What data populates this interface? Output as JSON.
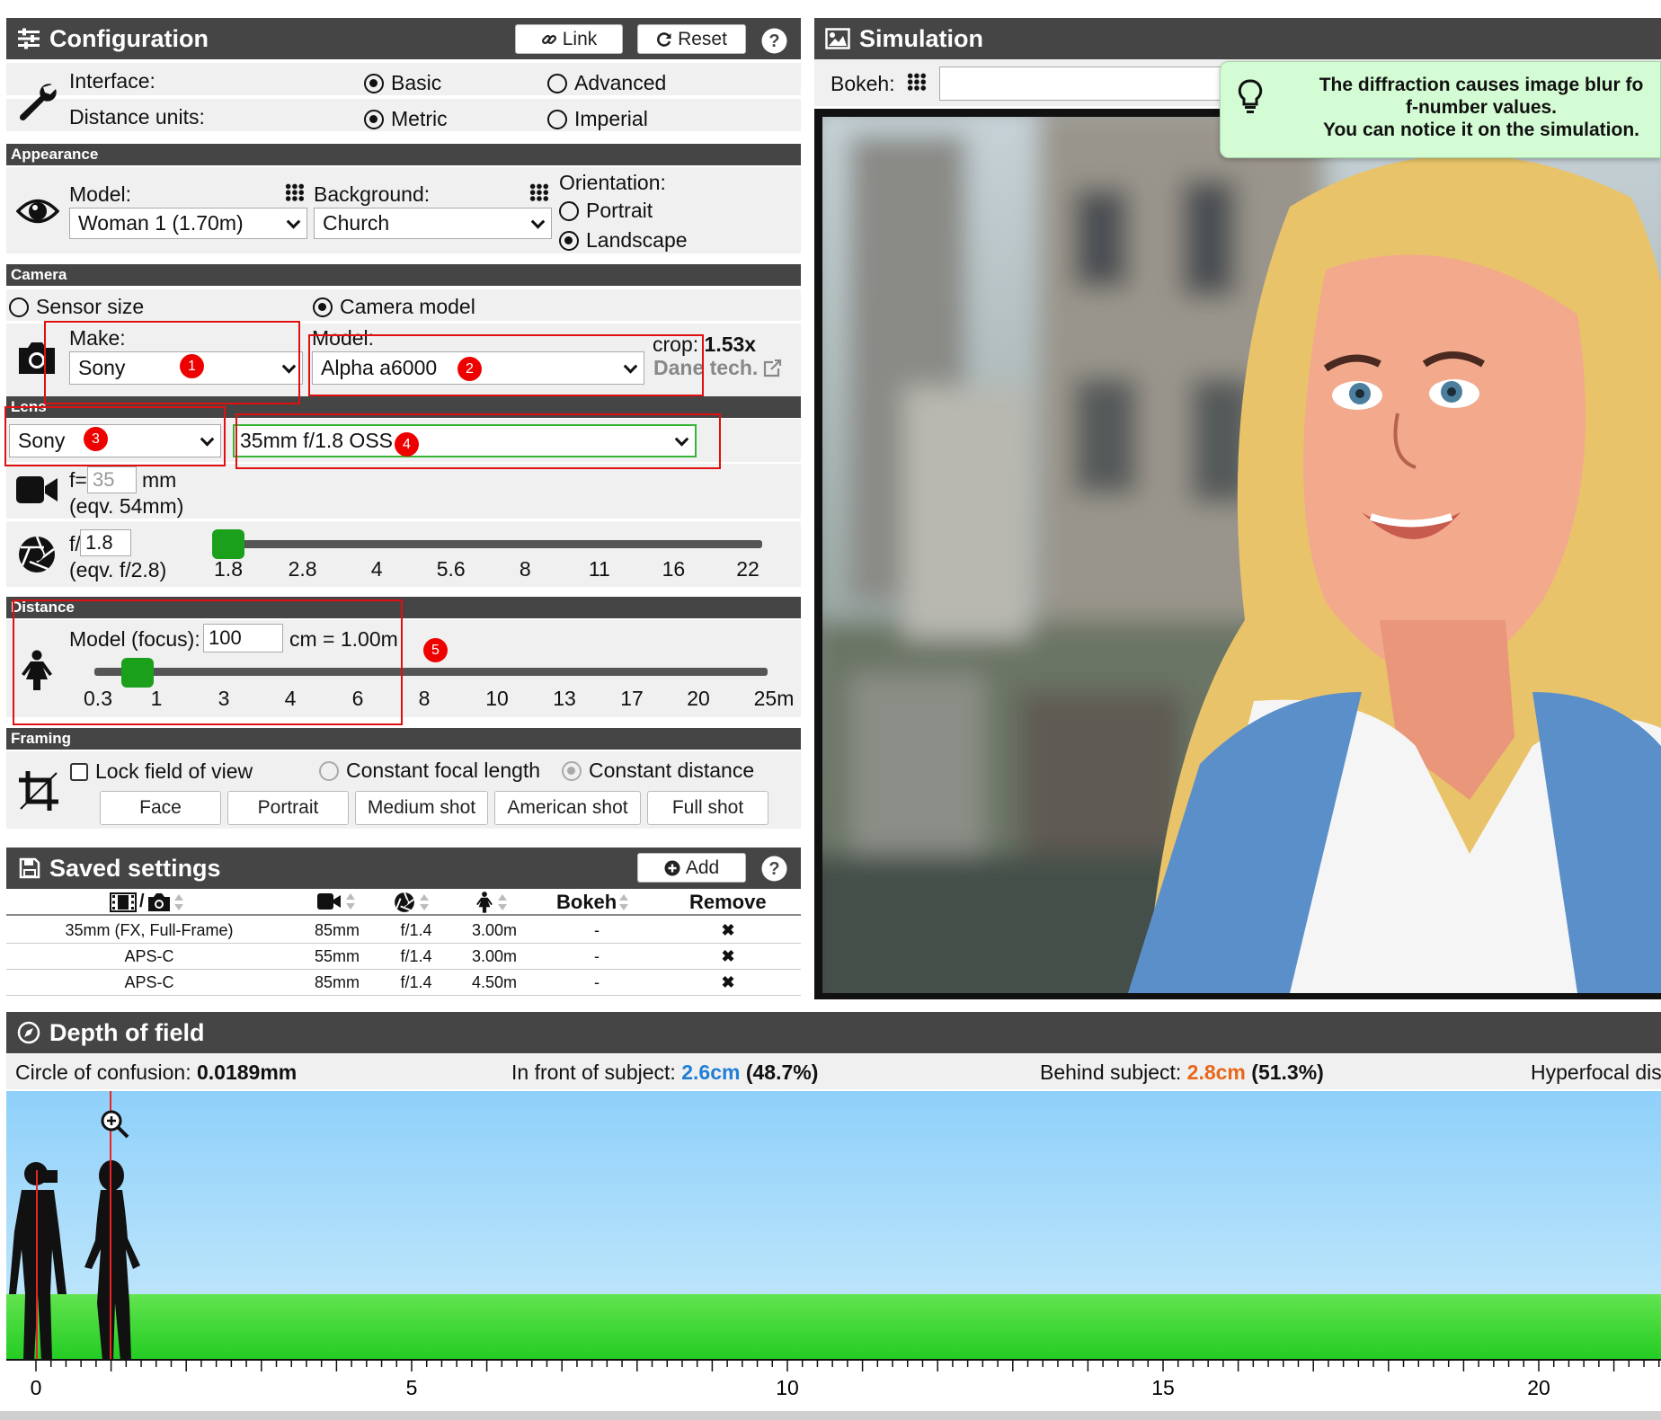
{
  "config": {
    "title": "Configuration",
    "link_label": "Link",
    "reset_label": "Reset",
    "interface_label": "Interface:",
    "interface_basic": "Basic",
    "interface_advanced": "Advanced",
    "units_label": "Distance units:",
    "units_metric": "Metric",
    "units_imperial": "Imperial"
  },
  "appearance": {
    "header": "Appearance",
    "model_label": "Model:",
    "model_value": "Woman 1 (1.70m)",
    "background_label": "Background:",
    "background_value": "Church",
    "orientation_label": "Orientation:",
    "portrait": "Portrait",
    "landscape": "Landscape"
  },
  "camera": {
    "header": "Camera",
    "sensor_size": "Sensor size",
    "camera_model": "Camera model",
    "make_label": "Make:",
    "make_value": "Sony",
    "model_label": "Model:",
    "model_value": "Alpha a6000",
    "crop_label": "crop:",
    "crop_value": "1.53x",
    "source_link": "Dane tech."
  },
  "lens": {
    "header": "Lens",
    "brand": "Sony",
    "lens_value": "35mm f/1.8 OSS",
    "focal_prefix": "f=",
    "focal_value": "35",
    "focal_unit": "mm",
    "focal_eqv": "(eqv. 54mm)",
    "aperture_prefix": "f/",
    "aperture_value": "1.8",
    "aperture_eqv": "(eqv. f/2.8)",
    "aperture_ticks": [
      "1.8",
      "2.8",
      "4",
      "5.6",
      "8",
      "11",
      "16",
      "22"
    ],
    "aperture_position": 0
  },
  "distance": {
    "header": "Distance",
    "label": "Model (focus):",
    "value": "100",
    "unit_text": "cm = 1.00m",
    "ticks": [
      "0.3",
      "1",
      "3",
      "4",
      "6",
      "8",
      "10",
      "13",
      "17",
      "20",
      "25m"
    ],
    "slider_position": 0.066
  },
  "framing": {
    "header": "Framing",
    "lock_fov": "Lock field of view",
    "constant_focal": "Constant focal length",
    "constant_distance": "Constant distance",
    "buttons": [
      "Face",
      "Portrait",
      "Medium shot",
      "American shot",
      "Full shot"
    ]
  },
  "saved": {
    "title": "Saved settings",
    "add_label": "Add",
    "bokeh_header": "Bokeh",
    "remove_header": "Remove",
    "rows": [
      {
        "format": "35mm (FX, Full-Frame)",
        "focal": "85mm",
        "aperture": "f/1.4",
        "distance": "3.00m",
        "bokeh": "-",
        "remove": "✖"
      },
      {
        "format": "APS-C",
        "focal": "55mm",
        "aperture": "f/1.4",
        "distance": "3.00m",
        "bokeh": "-",
        "remove": "✖"
      },
      {
        "format": "APS-C",
        "focal": "85mm",
        "aperture": "f/1.4",
        "distance": "4.50m",
        "bokeh": "-",
        "remove": "✖"
      }
    ]
  },
  "simulation": {
    "title": "Simulation",
    "bokeh_label": "Bokeh:",
    "tooltip_line1": "The diffraction causes image blur fo",
    "tooltip_line2": "f-number values.",
    "tooltip_line3": "You can notice it on the simulation."
  },
  "dof": {
    "title": "Depth of field",
    "coc_label": "Circle of confusion:",
    "coc_value": "0.0189mm",
    "front_label": "In front of subject:",
    "front_value": "2.6cm",
    "front_pct": "(48.7%)",
    "behind_label": "Behind subject:",
    "behind_value": "2.8cm",
    "behind_pct": "(51.3%)",
    "hyperfocal_label": "Hyperfocal dis",
    "axis_ticks": [
      "0",
      "5",
      "10",
      "15",
      "20"
    ],
    "badges": [
      "1",
      "2",
      "3",
      "4",
      "5"
    ]
  },
  "colors": {
    "header_bg": "#454545",
    "slider_green": "#1aa01a",
    "front_blue": "#1f7fd6",
    "behind_orange": "#e8671a",
    "tooltip_bg": "#d4fcd4",
    "annotation_red": "#e01010"
  }
}
